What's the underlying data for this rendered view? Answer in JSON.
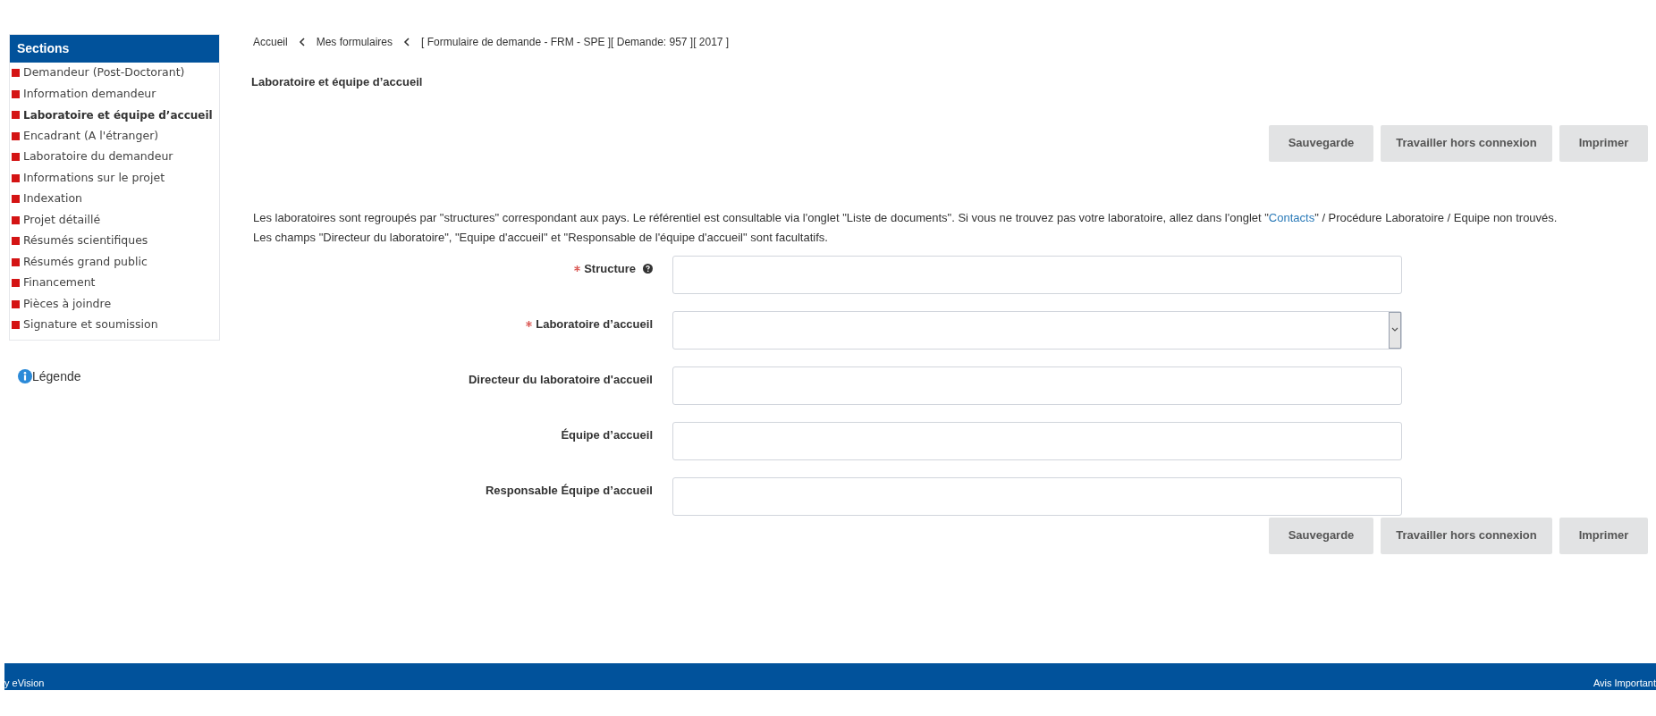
{
  "sidebar": {
    "title": "Sections",
    "items": [
      {
        "label": "Demandeur (Post-Doctorant)",
        "selected": false
      },
      {
        "label": "Information demandeur",
        "selected": false
      },
      {
        "label": "Laboratoire et équipe d’accueil",
        "selected": true
      },
      {
        "label": "Encadrant (A l'étranger)",
        "selected": false
      },
      {
        "label": "Laboratoire du demandeur",
        "selected": false
      },
      {
        "label": "Informations sur le projet",
        "selected": false
      },
      {
        "label": "Indexation",
        "selected": false
      },
      {
        "label": "Projet détaillé",
        "selected": false
      },
      {
        "label": "Résumés scientifiques",
        "selected": false
      },
      {
        "label": "Résumés grand public",
        "selected": false
      },
      {
        "label": "Financement",
        "selected": false
      },
      {
        "label": "Pièces à joindre",
        "selected": false
      },
      {
        "label": "Signature et soumission",
        "selected": false
      }
    ],
    "legend": "Légende"
  },
  "breadcrumb": [
    "Accueil",
    "Mes formulaires",
    "[ Formulaire de demande - FRM - SPE ][ Demande: 957 ][ 2017 ]"
  ],
  "page_title": "Laboratoire et équipe d’accueil",
  "top_buttons": [
    "Sauvegarde",
    "Travailler hors connexion",
    "Imprimer"
  ],
  "intro": {
    "before": "Les laboratoires sont regroupés par \"structures\" correspondant aux pays. Le référentiel est consultable via l'onglet \"Liste de documents\". Si vous ne trouvez pas votre laboratoire, allez dans l'onglet \"",
    "link": "Contacts",
    "after": "\" / Procédure Laboratoire / Equipe non trouvés. Les champs \"Directeur du laboratoire\", \"Equipe d'accueil\" et \"Responsable de l'équipe d'accueil\" sont facultatifs."
  },
  "fields": [
    {
      "label": "Structure",
      "required": true,
      "help": true,
      "kind": "text"
    },
    {
      "label": "Laboratoire d’accueil",
      "required": true,
      "help": false,
      "kind": "select"
    },
    {
      "label": "Directeur du laboratoire d'accueil",
      "required": false,
      "help": false,
      "kind": "text"
    },
    {
      "label": "Équipe d’accueil",
      "required": false,
      "help": false,
      "kind": "text"
    },
    {
      "label": "Responsable Équipe d’accueil",
      "required": false,
      "help": false,
      "kind": "text"
    }
  ],
  "bottom_buttons": [
    "Sauvegarde",
    "Travailler hors connexion",
    "Imprimer"
  ],
  "footer": {
    "left": "y eVision",
    "right": "Avis Important"
  }
}
